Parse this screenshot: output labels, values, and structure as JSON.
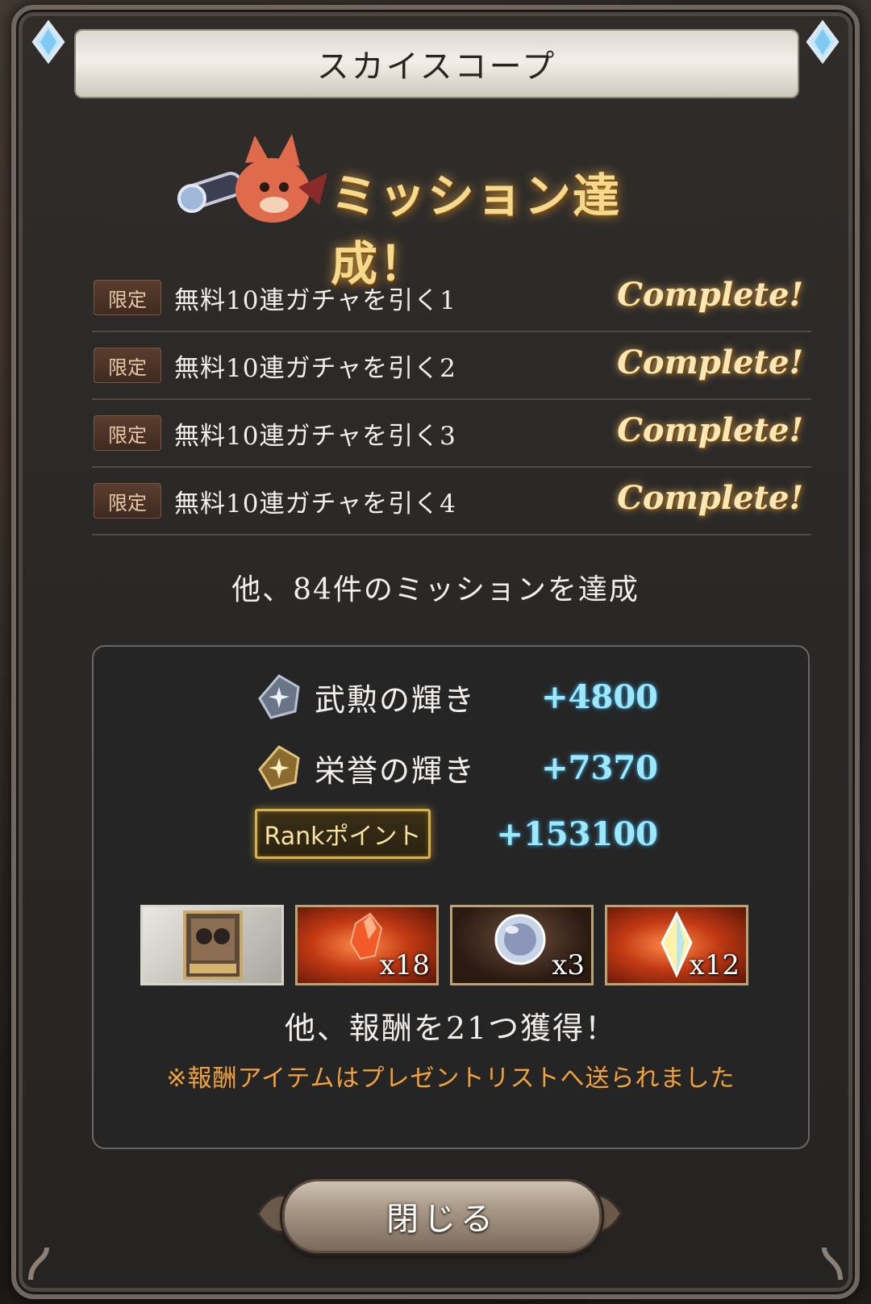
{
  "dialog": {
    "title": "スカイスコープ",
    "banner_text": "ミッション達成！"
  },
  "missions": [
    {
      "tag": "限定",
      "name": "無料10連ガチャを引く1",
      "status": "Complete!"
    },
    {
      "tag": "限定",
      "name": "無料10連ガチャを引く2",
      "status": "Complete!"
    },
    {
      "tag": "限定",
      "name": "無料10連ガチャを引く3",
      "status": "Complete!"
    },
    {
      "tag": "限定",
      "name": "無料10連ガチャを引く4",
      "status": "Complete!"
    }
  ],
  "other_missions_text": "他、84件のミッションを達成",
  "rewards": {
    "currencies": [
      {
        "icon": "silver-crest-icon",
        "label": "武勲の輝き",
        "value": "+4800"
      },
      {
        "icon": "gold-crest-icon",
        "label": "栄誉の輝き",
        "value": "+7370"
      },
      {
        "icon": "rank-badge",
        "label": "Rankポイント",
        "value": "+153100"
      }
    ],
    "items": [
      {
        "icon": "ticket-card-icon",
        "qty": "",
        "style": "white"
      },
      {
        "icon": "crystal-icon",
        "qty": "x18",
        "style": "orange"
      },
      {
        "icon": "summon-orb-icon",
        "qty": "x3",
        "style": "dark"
      },
      {
        "icon": "gem-icon",
        "qty": "x12",
        "style": "orange"
      }
    ],
    "other_rewards_text": "他、報酬を21つ獲得！",
    "notice_text": "※報酬アイテムはプレゼントリストへ送られました"
  },
  "close_button_label": "閉じる",
  "colors": {
    "complete": "#fbe7b6",
    "value": "#9fe7ff",
    "notice": "#f2a23c"
  }
}
